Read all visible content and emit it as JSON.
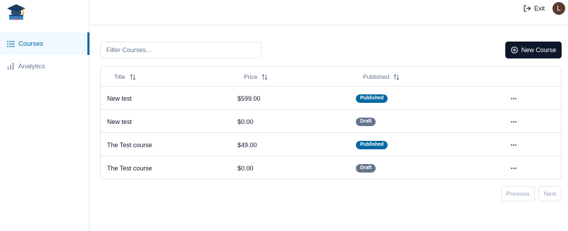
{
  "sidebar": {
    "logo_icon": "graduation-cap-icon",
    "items": [
      {
        "label": "Courses",
        "icon": "list-icon",
        "active": true
      },
      {
        "label": "Analytics",
        "icon": "bar-chart-icon",
        "active": false
      }
    ]
  },
  "header": {
    "exit_label": "Exit",
    "avatar_initial": "L"
  },
  "toolbar": {
    "filter_placeholder": "Filter Courses...",
    "filter_value": "",
    "new_course_label": "New Course"
  },
  "table": {
    "columns": [
      "Title",
      "Price",
      "Published"
    ],
    "rows": [
      {
        "title": "New test",
        "price": "$599.00",
        "status": "Published"
      },
      {
        "title": "New test",
        "price": "$0.00",
        "status": "Draft"
      },
      {
        "title": "The Test course",
        "price": "$49.00",
        "status": "Published"
      },
      {
        "title": "The Test course",
        "price": "$0.00",
        "status": "Draft"
      }
    ]
  },
  "pagination": {
    "previous_label": "Previous",
    "next_label": "Next"
  },
  "colors": {
    "primary": "#0f172a",
    "accent": "#0369a1",
    "draft": "#64748b",
    "border": "#e2e8f0"
  }
}
